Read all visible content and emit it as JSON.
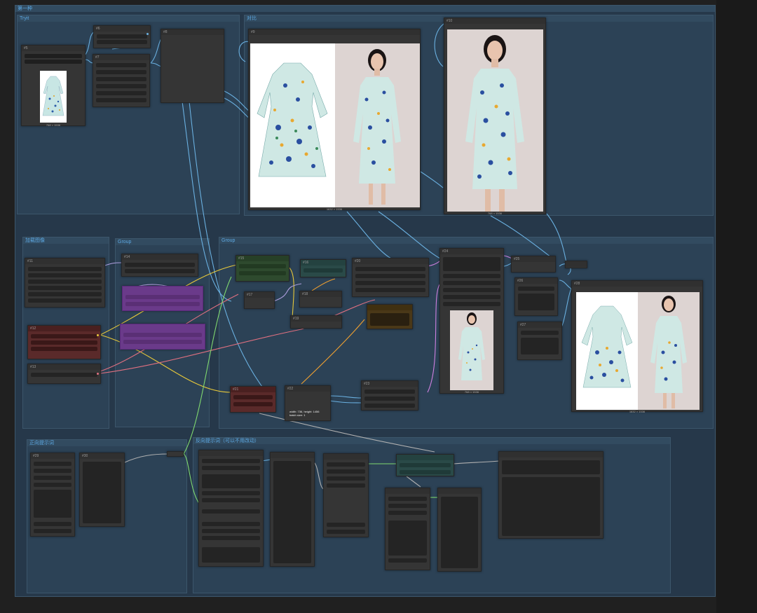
{
  "workflow": {
    "outer_group_title": "第一种",
    "groups": {
      "top_left": "Tryit",
      "top_compare": "对比",
      "mid_left": "加载图像",
      "mid_purple": "Group",
      "mid_main": "Group",
      "bottom_left": "正向提示词",
      "bottom_right": "反向提示词（可以不用改动）"
    },
    "nodes": {
      "load_image_caption": "768 × 1536",
      "compare_caption": "1632 × 1536",
      "preview_caption": "768 × 1536",
      "stitch_caption": "1632 × 1536",
      "mask_caption": "768 × 1536",
      "size_info": "width: 736, height: 1456\nbatch size: 1",
      "ids": [
        "#5",
        "#6",
        "#7",
        "#8",
        "#9",
        "#10",
        "#11",
        "#12",
        "#13",
        "#14",
        "#15",
        "#16",
        "#17",
        "#18",
        "#19",
        "#20",
        "#21",
        "#22",
        "#23",
        "#24",
        "#25",
        "#26",
        "#27",
        "#28",
        "#29",
        "#30"
      ]
    },
    "colors": {
      "canvas": "#202020",
      "group": "#2c4256",
      "group_title": "#5da9e3",
      "node": "#353535",
      "wire_blue": "#6ab0e0",
      "wire_yellow": "#e8c93a",
      "wire_pink": "#e07080",
      "wire_lavender": "#b0a0e0",
      "wire_orange": "#f0a030",
      "wire_green": "#7fd86f",
      "wire_gray": "#b0b0b0",
      "purple_node": "#6a3a8a",
      "red_node": "#5a2a2a",
      "green_node": "#2e4a2e",
      "teal_node": "#2a4a48",
      "brown_node": "#4a3818"
    }
  }
}
